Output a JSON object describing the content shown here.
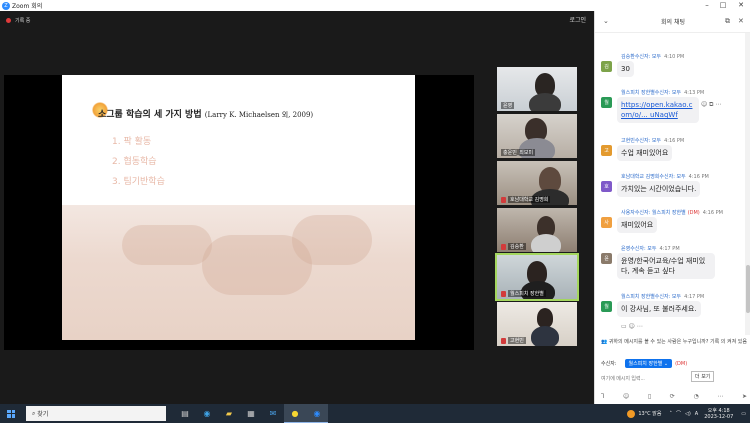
{
  "window": {
    "title": "Zoom 회의"
  },
  "zoom": {
    "recording_label": "기록 중",
    "pip_label": "로그인"
  },
  "slide": {
    "title": "소그룹 학습의 세 가지 방법",
    "title_cite": "(Larry K. Michaelsen 외, 2009)",
    "items": [
      "1. 팍 활동",
      "2. 협동학습",
      "3. 팀기반학습"
    ]
  },
  "participants": [
    {
      "name": "윤영"
    },
    {
      "name": "충운민_최보미"
    },
    {
      "name": "호남대학교 김명희"
    },
    {
      "name": "김승환"
    },
    {
      "name": "월스피치 장한별"
    },
    {
      "name": "고현빈"
    }
  ],
  "chat": {
    "title": "회의 채팅",
    "messages": [
      {
        "sender": "김승환",
        "to": "수신자: 모두",
        "time": "4:10 PM",
        "text": "30",
        "avatar": "김",
        "color": "#7da34a"
      },
      {
        "sender": "월스피치 장한별",
        "to": "수신자: 모두",
        "time": "4:13 PM",
        "text": "https://open.kakao.com/o/... uNaqWf",
        "avatar": "월",
        "color": "#2a9a56"
      },
      {
        "sender": "고현빈",
        "to": "수신자: 모두",
        "time": "4:16 PM",
        "text": "수업 재미있어요",
        "avatar": "고",
        "color": "#e39a2f"
      },
      {
        "sender": "호남대학교 김명희",
        "to": "수신자: 모두",
        "time": "4:16 PM",
        "text": "가치있는 시간이었습니다.",
        "avatar": "호",
        "color": "#7f59c9"
      },
      {
        "sender": "사용자",
        "to": "수신자: 월스피치 장한별",
        "dm": "(DM)",
        "time": "4:16 PM",
        "text": "재미있어요",
        "avatar": "사",
        "color": "#f0a040"
      },
      {
        "sender": "윤영",
        "to": "수신자: 모두",
        "time": "4:17 PM",
        "text": "윤영/한국어교육/수업 재미있다, 계속 듣고 싶다",
        "avatar": "윤",
        "color": "#8a7a6a"
      },
      {
        "sender": "월스피치 장한별",
        "to": "수신자: 모두",
        "time": "4:17 PM",
        "text": "이 강사님, 또 불러주세요.",
        "avatar": "월",
        "color": "#2a9a56"
      }
    ],
    "notice": "귀하의 메시지를 볼 수 있는 사람은 누구입니까? 기록 의 켜져 있음",
    "recipient_label": "수신자:",
    "recipient_value": "월스피치 장한별",
    "recipient_dm": "(DM)",
    "input_placeholder": "여기에 메시지 입력...",
    "more_tooltip": "더 보기"
  },
  "taskbar": {
    "search_label": "찾기",
    "weather": "13°C 맑음",
    "time": "오후 4:18",
    "date": "2023-12-07"
  },
  "colors": {
    "accent": "#0e72ed",
    "link": "#1a5ad6",
    "active_tile": "#a4d65e"
  }
}
